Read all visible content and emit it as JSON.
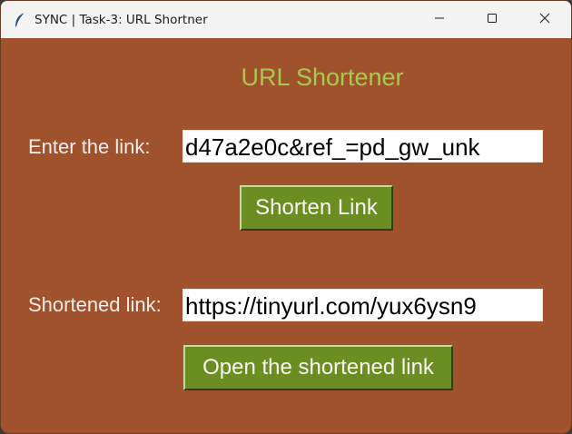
{
  "window": {
    "title": "SYNC | Task-3: URL Shortner",
    "icons": {
      "app": "feather-icon",
      "minimize": "minimize-icon",
      "maximize": "maximize-icon",
      "close": "close-icon"
    }
  },
  "main": {
    "heading": "URL Shortener",
    "link_label": "Enter the link:",
    "link_value": "d47a2e0c&ref_=pd_gw_unk",
    "shorten_button": "Shorten Link",
    "shortened_label": "Shortened link:",
    "shortened_value": "https://tinyurl.com/yux6ysn9",
    "open_button": "Open the shortened link"
  },
  "colors": {
    "background": "#a0522d",
    "heading": "#a9c94f",
    "button": "#6b8e23",
    "label": "#f2ede9"
  }
}
